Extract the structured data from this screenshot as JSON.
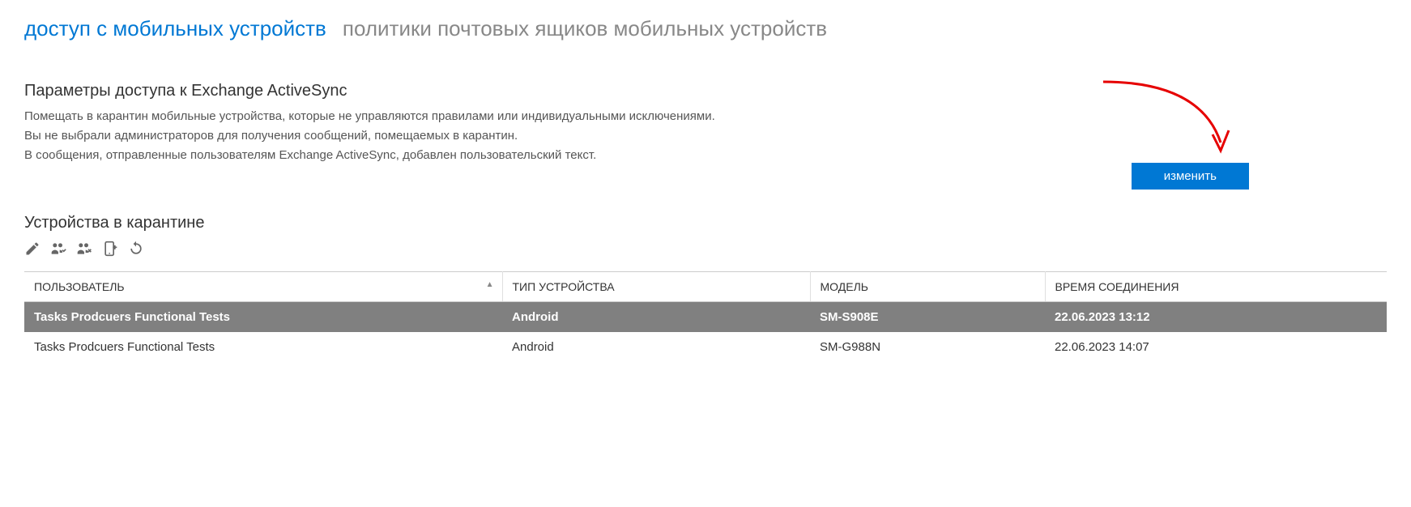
{
  "tabs": {
    "active": "доступ с мобильных устройств",
    "inactive": "политики почтовых ящиков мобильных устройств"
  },
  "settings": {
    "header": "Параметры доступа к Exchange ActiveSync",
    "line1": "Помещать в карантин мобильные устройства, которые не управляются правилами или индивидуальными исключениями.",
    "line2": "Вы не выбрали администраторов для получения сообщений, помещаемых в карантин.",
    "line3": "В сообщения, отправленные пользователям Exchange ActiveSync, добавлен пользовательский текст.",
    "edit_button": "изменить"
  },
  "quarantine": {
    "header": "Устройства в карантине",
    "columns": {
      "user": "ПОЛЬЗОВАТЕЛЬ",
      "type": "ТИП УСТРОЙСТВА",
      "model": "МОДЕЛЬ",
      "time": "ВРЕМЯ СОЕДИНЕНИЯ"
    },
    "rows": [
      {
        "user": "Tasks Prodcuers Functional Tests",
        "type": "Android",
        "model": "SM-S908E",
        "time": "22.06.2023 13:12",
        "selected": true
      },
      {
        "user": "Tasks Prodcuers Functional Tests",
        "type": "Android",
        "model": "SM-G988N",
        "time": "22.06.2023 14:07",
        "selected": false
      }
    ]
  }
}
